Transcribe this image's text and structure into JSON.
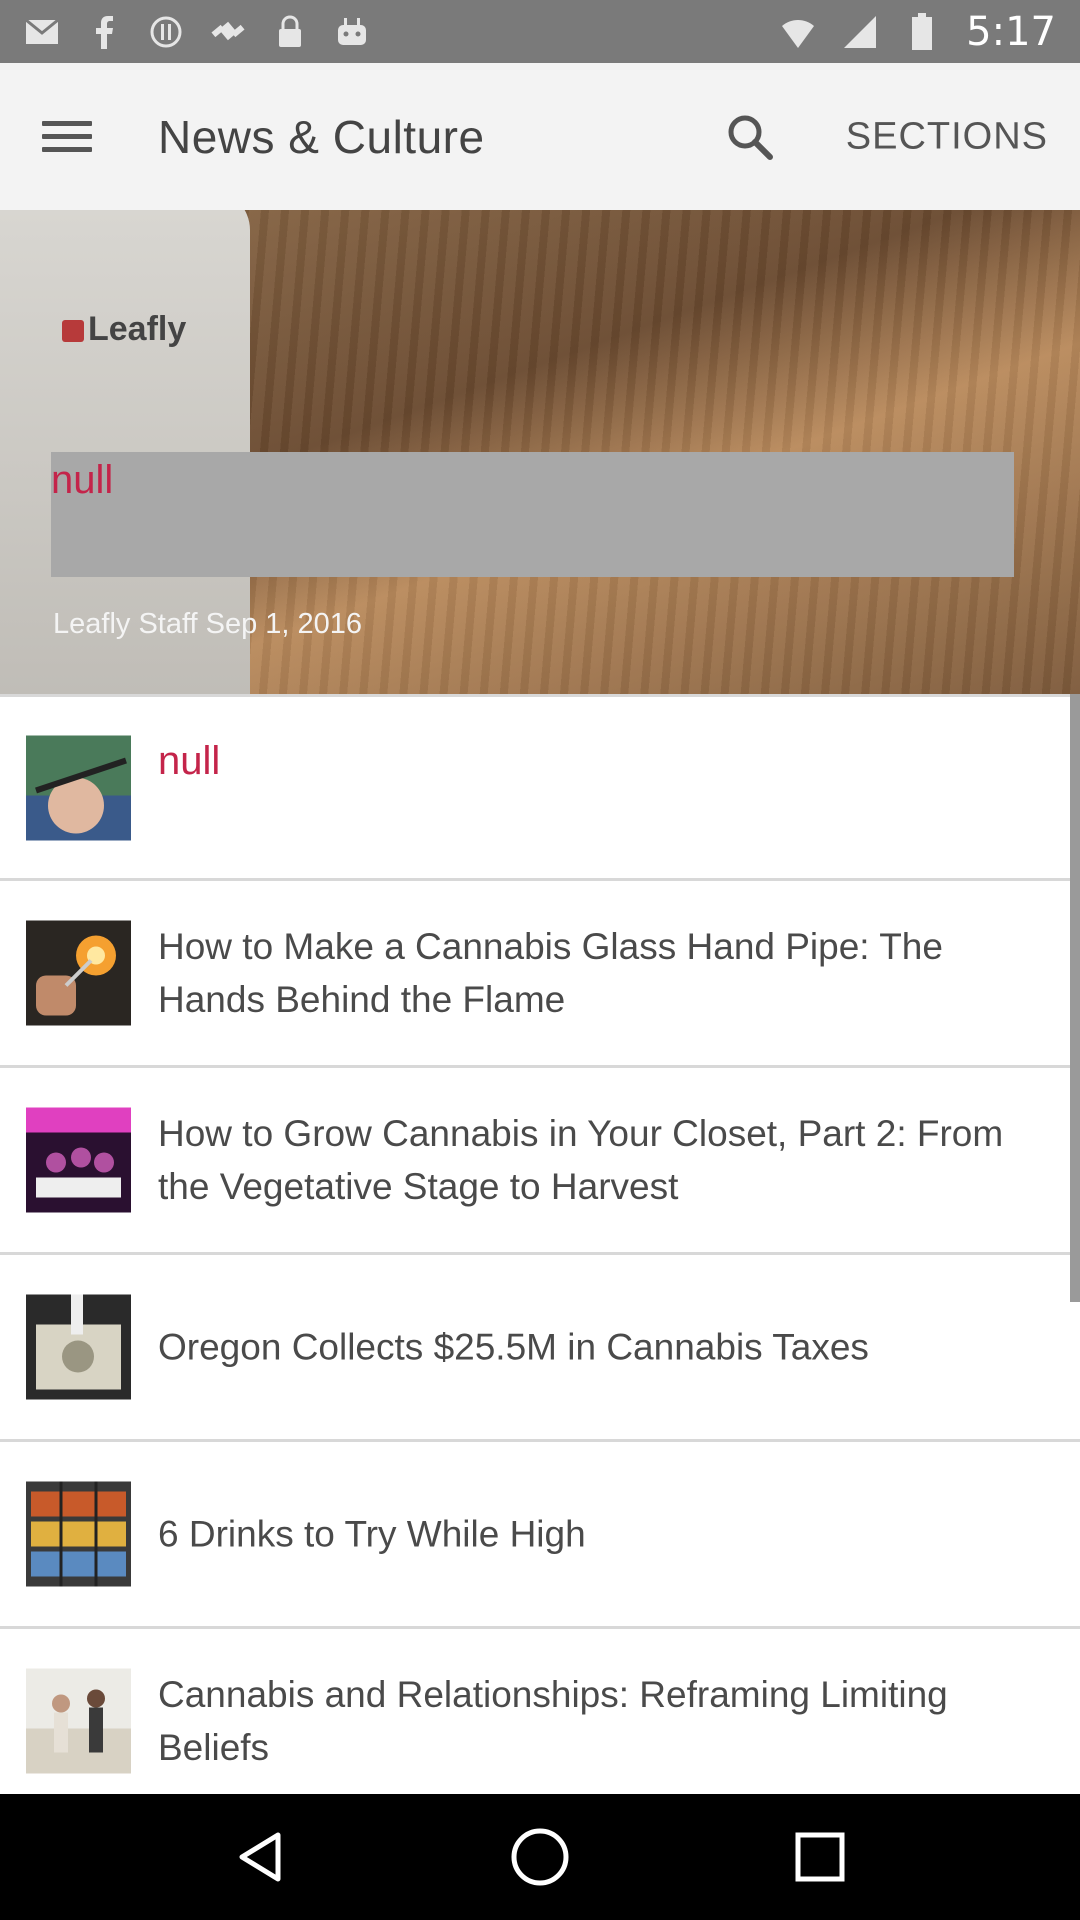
{
  "status_bar": {
    "time": "5:17",
    "icons_left": [
      "mail-icon",
      "facebook-icon",
      "alert-circle-icon",
      "fake-gps-icon",
      "lock-icon",
      "android-icon"
    ],
    "icons_right": [
      "network-icon",
      "signal-icon",
      "battery-icon"
    ]
  },
  "app_bar": {
    "title": "News & Culture",
    "sections_label": "SECTIONS",
    "menu_icon": "hamburger-menu-icon",
    "search_icon": "search-icon"
  },
  "hero": {
    "logo_text": "Leafly",
    "title": "null",
    "meta": "Leafly Staff Sep 1, 2016"
  },
  "articles": [
    {
      "title": "null",
      "thumb": "vape-pen-thumbnail"
    },
    {
      "title": "How to Make a Cannabis Glass Hand Pipe: The Hands Behind the Flame",
      "thumb": "glass-blowing-thumbnail"
    },
    {
      "title": "How to Grow Cannabis in Your Closet, Part 2: From the Vegetative Stage to Harvest",
      "thumb": "grow-lights-thumbnail"
    },
    {
      "title": "Oregon Collects $25.5M in Cannabis Taxes",
      "thumb": "money-thumbnail"
    },
    {
      "title": "6 Drinks to Try While High",
      "thumb": "drinks-fridge-thumbnail"
    },
    {
      "title": "Cannabis and Relationships: Reframing Limiting Beliefs",
      "thumb": "couple-thumbnail"
    }
  ],
  "nav_bar": {
    "back_icon": "back-triangle-icon",
    "home_icon": "home-circle-icon",
    "recents_icon": "recents-square-icon"
  },
  "colors": {
    "accent": "#c4244a",
    "status_bar": "#7a7a7a",
    "app_bar": "#f3f3f3"
  }
}
